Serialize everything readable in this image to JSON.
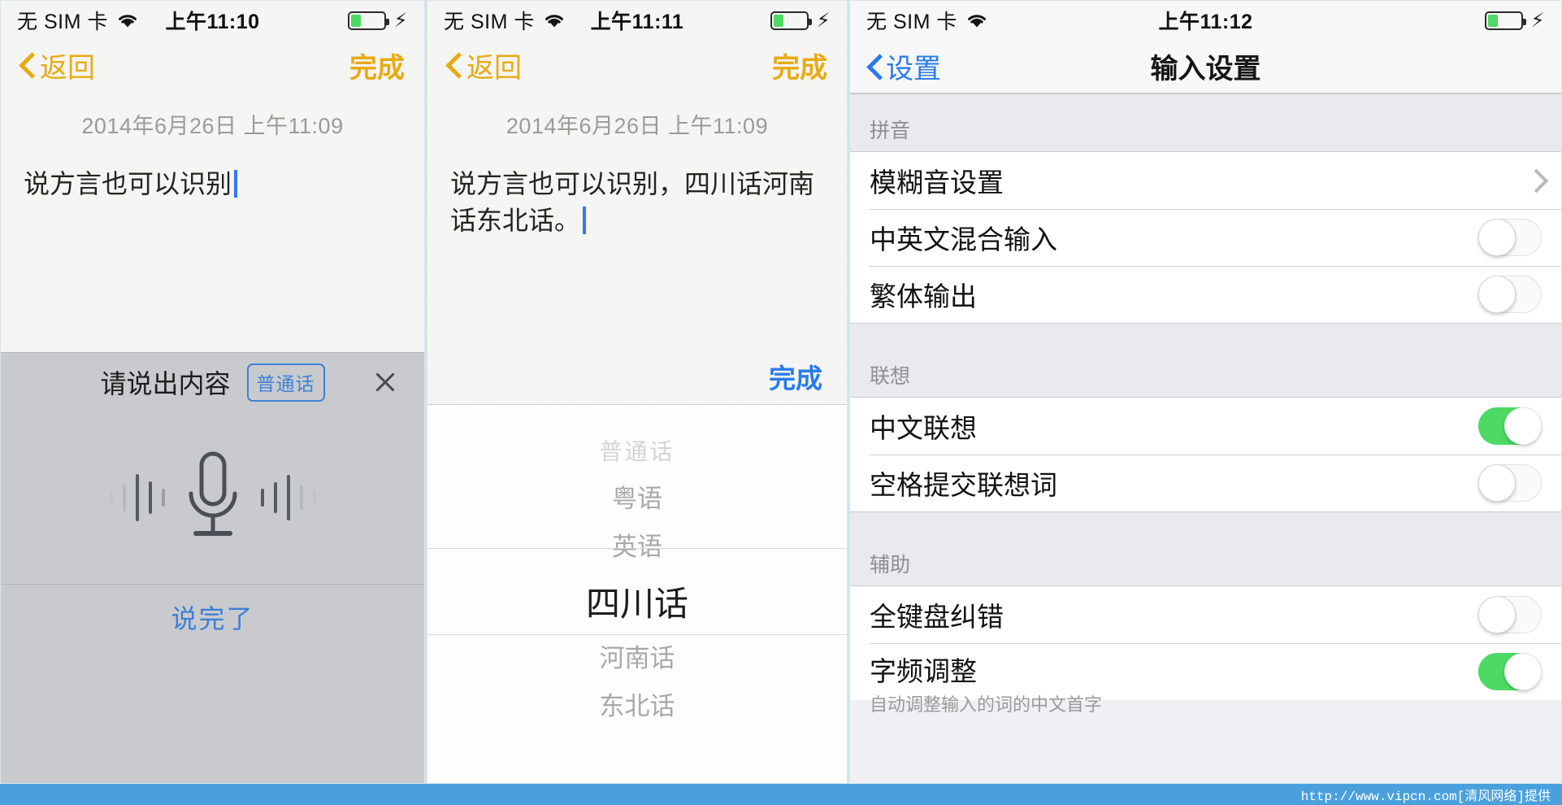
{
  "panels": {
    "left": {
      "status": {
        "carrier": "无 SIM 卡",
        "time": "上午11:10",
        "wifi_icon": "wifi-icon",
        "battery_icon": "battery-icon",
        "charging_icon": "lightning-bolt-icon"
      },
      "nav": {
        "back": "返回",
        "done": "完成"
      },
      "note": {
        "date": "2014年6月26日 上午11:09",
        "text": "说方言也可以识别"
      },
      "voice": {
        "title": "请说出内容",
        "language_chip": "普通话",
        "close_icon": "close-icon",
        "mic_icon": "microphone-icon",
        "finish": "说完了"
      }
    },
    "middle": {
      "status": {
        "carrier": "无 SIM 卡",
        "time": "上午11:11",
        "wifi_icon": "wifi-icon",
        "battery_icon": "battery-icon",
        "charging_icon": "lightning-bolt-icon"
      },
      "nav": {
        "back": "返回",
        "done": "完成"
      },
      "note": {
        "date": "2014年6月26日 上午11:09",
        "text": "说方言也可以识别，四川话河南话东北话。"
      },
      "picker": {
        "done": "完成",
        "options": [
          "普通话",
          "粤语",
          "英语",
          "四川话",
          "河南话",
          "东北话"
        ],
        "selected": "四川话",
        "selected_index": 3
      }
    },
    "right": {
      "status": {
        "carrier": "无 SIM 卡",
        "time": "上午11:12",
        "wifi_icon": "wifi-icon",
        "battery_icon": "battery-icon",
        "charging_icon": "lightning-bolt-icon"
      },
      "nav": {
        "back": "设置",
        "title": "输入设置",
        "back_icon": "chevron-left-icon"
      },
      "sections": [
        {
          "header": "拼音",
          "rows": [
            {
              "label": "模糊音设置",
              "control": "chevron",
              "control_icon": "chevron-right-icon"
            },
            {
              "label": "中英文混合输入",
              "control": "toggle",
              "value": false
            },
            {
              "label": "繁体输出",
              "control": "toggle",
              "value": false
            }
          ]
        },
        {
          "header": "联想",
          "rows": [
            {
              "label": "中文联想",
              "control": "toggle",
              "value": true
            },
            {
              "label": "空格提交联想词",
              "control": "toggle",
              "value": false
            }
          ]
        },
        {
          "header": "辅助",
          "rows": [
            {
              "label": "全键盘纠错",
              "control": "toggle",
              "value": false
            },
            {
              "label": "字频调整",
              "sub": "自动调整输入的词的中文首字",
              "control": "toggle",
              "value": true
            }
          ]
        }
      ]
    }
  },
  "watermark": {
    "text": "http://www.vipcn.com[清风网络]提供"
  },
  "colors": {
    "accent_yellow": "#e8aa14",
    "accent_blue": "#2a7bea",
    "toggle_on_green": "#4cd964",
    "watermark_bar": "#49a0dd"
  }
}
